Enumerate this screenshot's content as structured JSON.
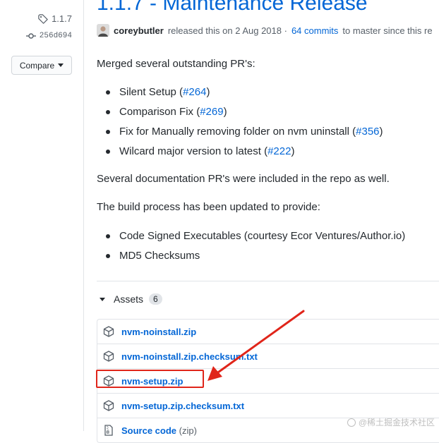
{
  "release": {
    "tag": "1.1.7",
    "commit": "256d694",
    "compare_label": "Compare",
    "title": "1.1.7 - Maintenance Release",
    "author": "coreybutler",
    "released_text": "released this on 2 Aug 2018 ·",
    "commits_link": "64 commits",
    "commits_suffix": "to master since this re"
  },
  "body": {
    "intro": "Merged several outstanding PR's:",
    "prs": [
      {
        "text": "Silent Setup (",
        "link": "#264",
        "close": ")"
      },
      {
        "text": "Comparison Fix (",
        "link": "#269",
        "close": ")"
      },
      {
        "text": "Fix for Manually removing folder on nvm uninstall (",
        "link": "#356",
        "close": ")"
      },
      {
        "text": "Wilcard major version to latest (",
        "link": "#222",
        "close": ")"
      }
    ],
    "docs_line": "Several documentation PR's were included in the repo as well.",
    "build_line": "The build process has been updated to provide:",
    "build_items": [
      "Code Signed Executables (courtesy Ecor Ventures/Author.io)",
      "MD5 Checksums"
    ]
  },
  "assets": {
    "header": "Assets",
    "count": "6",
    "items": [
      {
        "name": "nvm-noinstall.zip"
      },
      {
        "name": "nvm-noinstall.zip.checksum.txt"
      },
      {
        "name": "nvm-setup.zip"
      },
      {
        "name": "nvm-setup.zip.checksum.txt"
      }
    ],
    "source": {
      "name": "Source code",
      "ext": "(zip)"
    }
  },
  "annotation": {
    "color": "#e0251a"
  },
  "watermark": "@稀土掘金技术社区"
}
